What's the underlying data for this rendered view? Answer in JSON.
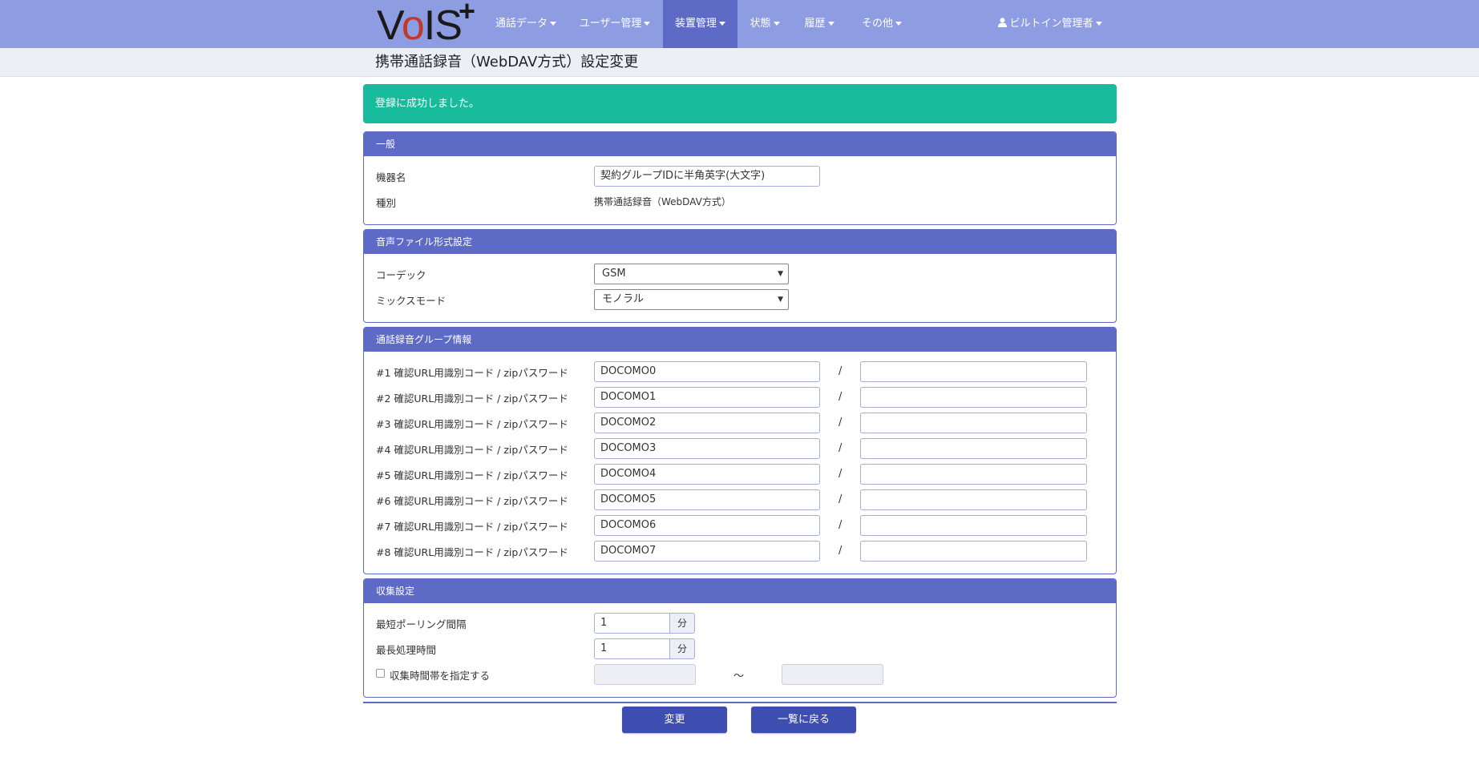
{
  "navbar": {
    "logo": {
      "v": "V",
      "o": "o",
      "is": "IS",
      "plus": "+"
    },
    "items": [
      "通話データ",
      "ユーザー管理",
      "装置管理",
      "状態",
      "履歴",
      "その他"
    ],
    "user": "ビルトイン管理者",
    "colors": {
      "bar": "#8e9de2",
      "active": "#5d6bc7"
    }
  },
  "page": {
    "title": "携帯通話録音（WebDAV方式）設定変更"
  },
  "alert": {
    "message": "登録に成功しました。",
    "color": "#18bc9c"
  },
  "general": {
    "heading": "一般",
    "device_name_label": "機器名",
    "device_name_value": "契約グループIDに半角英字(大文字)",
    "type_label": "種別",
    "type_value": "携帯通話録音（WebDAV方式）"
  },
  "audio": {
    "heading": "音声ファイル形式設定",
    "codec_label": "コーデック",
    "codec_value": "GSM",
    "mix_label": "ミックスモード",
    "mix_value": "モノラル"
  },
  "groups": {
    "heading": "通話録音グループ情報",
    "rows": [
      {
        "label": "#1 確認URL用識別コード / zipパスワード",
        "code": "DOCOMO0",
        "password": ""
      },
      {
        "label": "#2 確認URL用識別コード / zipパスワード",
        "code": "DOCOMO1",
        "password": ""
      },
      {
        "label": "#3 確認URL用識別コード / zipパスワード",
        "code": "DOCOMO2",
        "password": ""
      },
      {
        "label": "#4 確認URL用識別コード / zipパスワード",
        "code": "DOCOMO3",
        "password": ""
      },
      {
        "label": "#5 確認URL用識別コード / zipパスワード",
        "code": "DOCOMO4",
        "password": ""
      },
      {
        "label": "#6 確認URL用識別コード / zipパスワード",
        "code": "DOCOMO5",
        "password": ""
      },
      {
        "label": "#7 確認URL用識別コード / zipパスワード",
        "code": "DOCOMO6",
        "password": ""
      },
      {
        "label": "#8 確認URL用識別コード / zipパスワード",
        "code": "DOCOMO7",
        "password": ""
      }
    ],
    "separator": "/"
  },
  "collection": {
    "heading": "収集設定",
    "polling_label": "最短ポーリング間隔",
    "polling_value": "1",
    "polling_unit": "分",
    "max_label": "最長処理時間",
    "max_value": "1",
    "max_unit": "分",
    "timeband_label": "収集時間帯を指定する",
    "timeband_from": "",
    "timeband_to": "",
    "tilde": "～"
  },
  "buttons": {
    "change": "変更",
    "back": "一覧に戻る"
  }
}
